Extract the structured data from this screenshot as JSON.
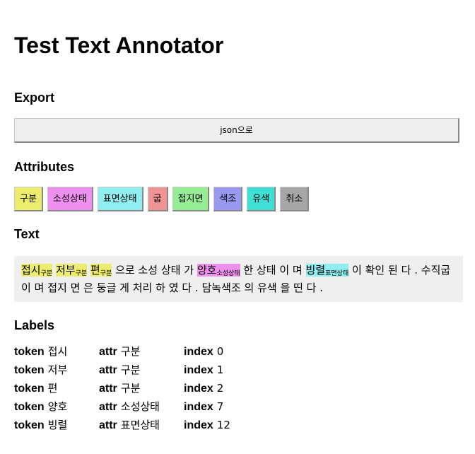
{
  "title": "Test Text Annotator",
  "export": {
    "heading": "Export",
    "button_label": "json으로"
  },
  "attributes": {
    "heading": "Attributes",
    "items": [
      {
        "label": "구분",
        "color": "#ecec6e"
      },
      {
        "label": "소성상태",
        "color": "#ee90ee"
      },
      {
        "label": "표면상태",
        "color": "#90eef0"
      },
      {
        "label": "굽",
        "color": "#ef9393"
      },
      {
        "label": "접지면",
        "color": "#95ee95"
      },
      {
        "label": "색조",
        "color": "#9898ef"
      },
      {
        "label": "유색",
        "color": "#3ee0d6"
      },
      {
        "label": "취소",
        "color": "#a6a6a6"
      }
    ]
  },
  "text": {
    "heading": "Text",
    "tokens": [
      {
        "t": "접시",
        "attr": "구분",
        "color": "#ecec6e"
      },
      {
        "t": "저부",
        "attr": "구분",
        "color": "#ecec6e"
      },
      {
        "t": "편",
        "attr": "구분",
        "color": "#ecec6e"
      },
      {
        "t": "으로"
      },
      {
        "t": "소성"
      },
      {
        "t": "상태"
      },
      {
        "t": "가"
      },
      {
        "t": "양호",
        "attr": "소성상태",
        "color": "#ee90ee"
      },
      {
        "t": "한"
      },
      {
        "t": "상태"
      },
      {
        "t": "이"
      },
      {
        "t": "며"
      },
      {
        "t": "빙렬",
        "attr": "표면상태",
        "color": "#90eef0"
      },
      {
        "t": "이"
      },
      {
        "t": "확인"
      },
      {
        "t": "된"
      },
      {
        "t": "다"
      },
      {
        "t": "."
      },
      {
        "t": "수직굽"
      },
      {
        "t": "이"
      },
      {
        "t": "며"
      },
      {
        "t": "접지"
      },
      {
        "t": "면"
      },
      {
        "t": "은"
      },
      {
        "t": "둥글"
      },
      {
        "t": "게"
      },
      {
        "t": "처리"
      },
      {
        "t": "하"
      },
      {
        "t": "였"
      },
      {
        "t": "다"
      },
      {
        "t": "."
      },
      {
        "t": "담녹색조"
      },
      {
        "t": "의"
      },
      {
        "t": "유색"
      },
      {
        "t": "을"
      },
      {
        "t": "띤"
      },
      {
        "t": "다"
      },
      {
        "t": "."
      }
    ]
  },
  "labels": {
    "heading": "Labels",
    "key_token": "token",
    "key_attr": "attr",
    "key_index": "index",
    "rows": [
      {
        "token": "접시",
        "attr": "구분",
        "index": "0"
      },
      {
        "token": "저부",
        "attr": "구분",
        "index": "1"
      },
      {
        "token": "편",
        "attr": "구분",
        "index": "2"
      },
      {
        "token": "양호",
        "attr": "소성상태",
        "index": "7"
      },
      {
        "token": "빙렬",
        "attr": "표면상태",
        "index": "12"
      }
    ]
  }
}
